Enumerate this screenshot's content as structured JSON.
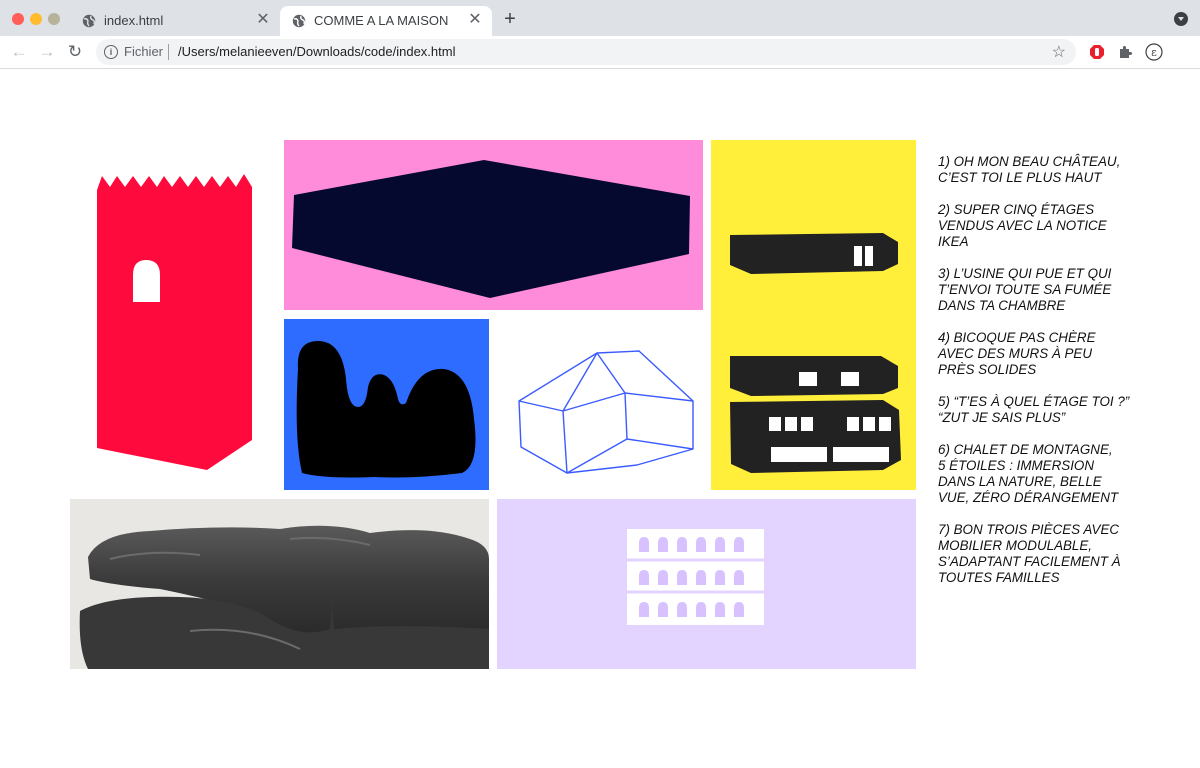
{
  "browser": {
    "tabs": [
      {
        "title": "index.html",
        "active": false,
        "icon": "globe-icon"
      },
      {
        "title": "COMME A LA MAISON",
        "active": true,
        "icon": "globe-icon"
      }
    ],
    "address_bar": {
      "scheme_label": "Fichier",
      "url": "/Users/melanieeven/Downloads/code/index.html"
    },
    "colors": {
      "chrome": "#dee1e6",
      "omnibox": "#f1f3f4",
      "ext_red": "#e8202e"
    }
  },
  "gallery": {
    "tiles": [
      {
        "name": "red-tower",
        "bg": "#ffffff",
        "shape": "#ff0a3c"
      },
      {
        "name": "navy-hexagon",
        "bg": "#ff8bdb",
        "shape": "#050930"
      },
      {
        "name": "yellow-buildings",
        "bg": "#ffef3a",
        "shape": "#222222"
      },
      {
        "name": "black-chalet",
        "bg": "#2e6cff",
        "shape": "#000000"
      },
      {
        "name": "house-sketch",
        "bg": "#ffffff",
        "shape": "#3b5bff"
      },
      {
        "name": "rock-photo",
        "bg": "#e9e7e4",
        "shape": "#3a3a3a"
      },
      {
        "name": "lavender-block",
        "bg": "#e3d3ff",
        "shape": "#ffffff"
      }
    ]
  },
  "captions": [
    {
      "line1": "1) OH MON BEAU CHÂTEAU,",
      "line2": "C’EST TOI LE PLUS HAUT"
    },
    {
      "line1": "2) SUPER CINQ ÉTAGES",
      "line2": "VENDUS AVEC LA NOTICE",
      "line3": "IKEA"
    },
    {
      "line1": "3) L’USINE QUI PUE ET QUI",
      "line2": "T’ENVOI TOUTE SA FUMÉE",
      "line3": "DANS TA CHAMBRE"
    },
    {
      "line1": "4) BICOQUE PAS CHÈRE",
      "line2": "AVEC DES MURS À PEU",
      "line3": "PRÈS SOLIDES"
    },
    {
      "line1": "5) “T’ES À QUEL ÉTAGE TOI ?”",
      "line2": "“ZUT JE SAIS PLUS”"
    },
    {
      "line1": "6) CHALET DE MONTAGNE,",
      "line2": "5 ÉTOILES : IMMERSION",
      "line3": "DANS LA NATURE, BELLE",
      "line4": "VUE, ZÉRO DÉRANGEMENT"
    },
    {
      "line1": "7) BON TROIS PIÈCES AVEC",
      "line2": "MOBILIER MODULABLE,",
      "line3": "S’ADAPTANT FACILEMENT À",
      "line4": "TOUTES FAMILLES"
    }
  ]
}
